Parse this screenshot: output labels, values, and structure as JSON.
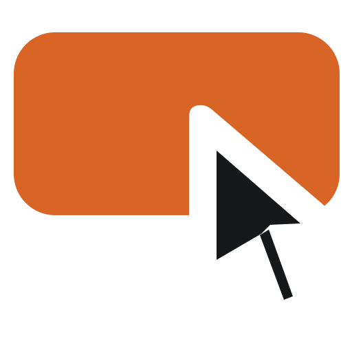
{
  "icon": {
    "name": "click-button-icon",
    "parts": [
      "button-icon",
      "cursor-icon"
    ],
    "colors": {
      "button": "#D86526",
      "cursor": "#151719",
      "cursor_outline": "#FFFFFF",
      "background": "#FFFFFF"
    }
  }
}
